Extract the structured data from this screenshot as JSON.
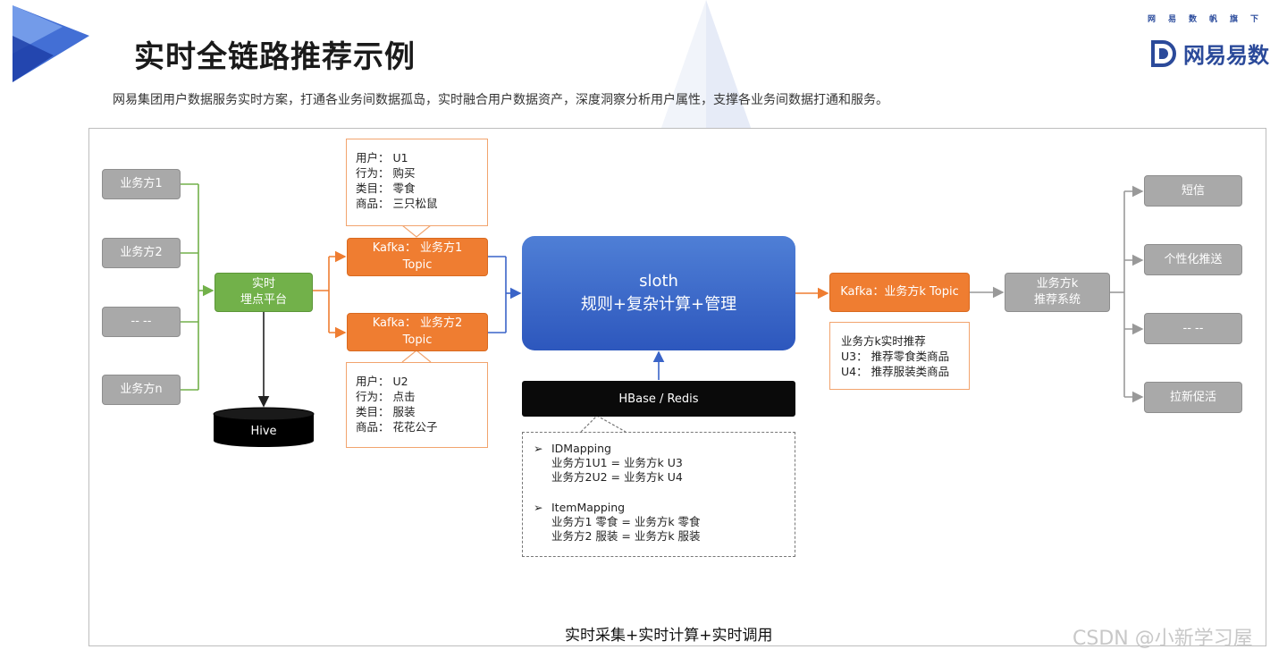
{
  "header": {
    "title": "实时全链路推荐示例",
    "subtitle": "网易集团用户数据服务实时方案，打通各业务间数据孤岛，实时融合用户数据资产，深度洞察分析用户属性，支撑各业务间数据打通和服务。",
    "brand_small": "网易数帆旗下",
    "brand_name": "网易易数"
  },
  "sources": [
    "业务方1",
    "业务方2",
    "-- --",
    "业务方n"
  ],
  "collector": {
    "line1": "实时",
    "line2": "埋点平台"
  },
  "hive": "Hive",
  "kafka1": {
    "line1": "Kafka：  业务方1",
    "line2": "Topic"
  },
  "kafka2": {
    "line1": "Kafka：  业务方2",
    "line2": "Topic"
  },
  "note1": [
    "用户：  U1",
    "行为：  购买",
    "类目：  零食",
    "商品：  三只松鼠"
  ],
  "note2": [
    "用户：  U2",
    "行为：  点击",
    "类目：  服装",
    "商品：  花花公子"
  ],
  "sloth": {
    "line1": "sloth",
    "line2": "规则+复杂计算+管理"
  },
  "storage": "HBase / Redis",
  "mapping": {
    "id_title": "IDMapping",
    "id_lines": [
      "业务方1U1 = 业务方k U3",
      "业务方2U2 = 业务方k U4"
    ],
    "item_title": "ItemMapping",
    "item_lines": [
      "业务方1 零食 = 业务方k 零食",
      "业务方2 服装 = 业务方k 服装"
    ]
  },
  "kafkak": "Kafka：业务方k Topic",
  "note3": [
    "业务方k实时推荐",
    "U3：  推荐零食类商品",
    "U4：  推荐服装类商品"
  ],
  "recsys": {
    "line1": "业务方k",
    "line2": "推荐系统"
  },
  "outputs": [
    "短信",
    "个性化推送",
    "-- --",
    "拉新促活"
  ],
  "footer": "实时采集+实时计算+实时调用",
  "watermark": "CSDN @小新学习屋",
  "colors": {
    "green": "#72b14a",
    "orange": "#ef7d31",
    "blue": "#2d57bd",
    "gray": "#a9a9a9",
    "brand": "#2b4a9a"
  }
}
